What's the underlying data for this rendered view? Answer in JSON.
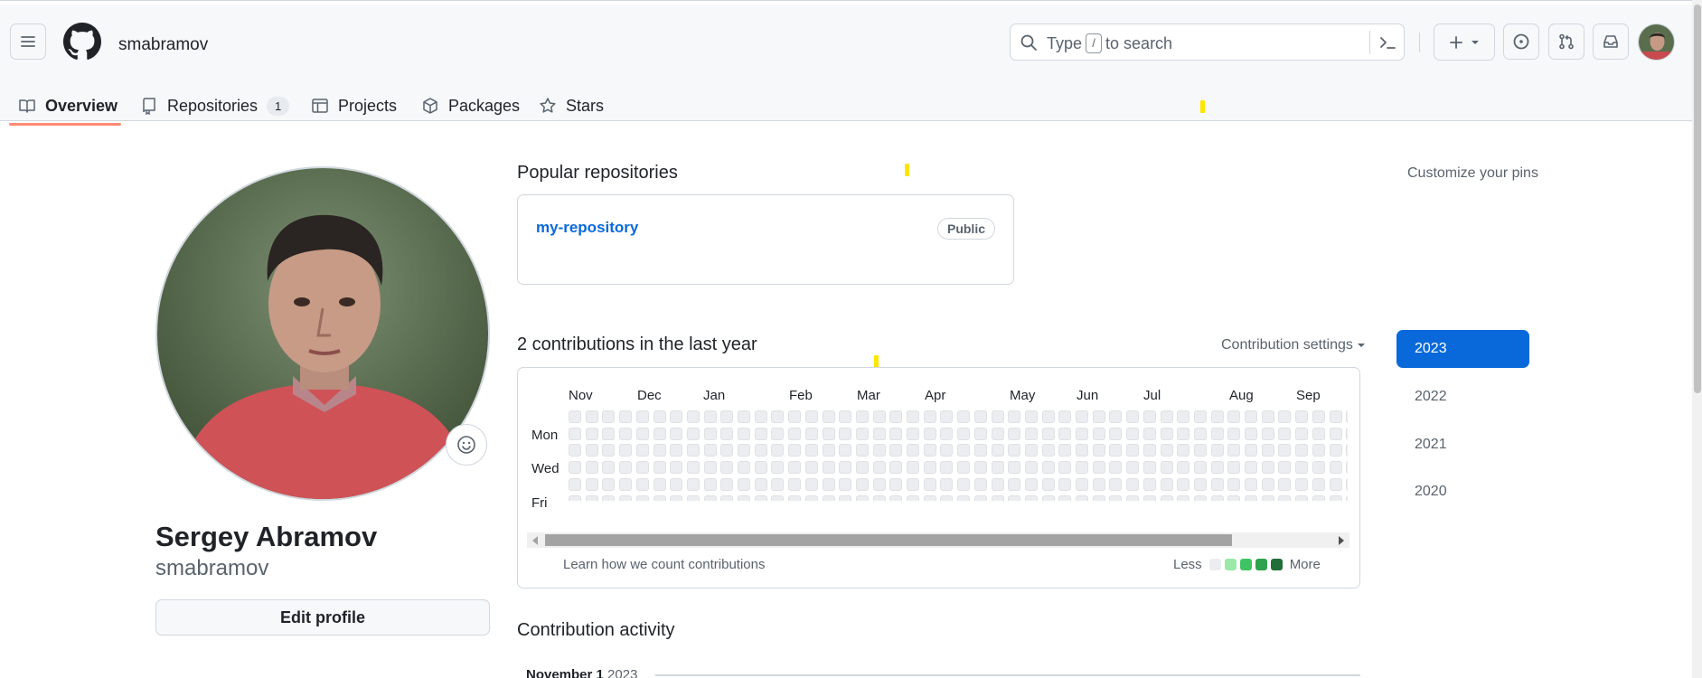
{
  "header": {
    "username": "smabramov",
    "search": {
      "prefix": "Type",
      "key": "/",
      "suffix": "to search"
    }
  },
  "tabs": [
    {
      "label": "Overview",
      "icon": "book-icon",
      "active": true
    },
    {
      "label": "Repositories",
      "icon": "repo-icon",
      "count": "1"
    },
    {
      "label": "Projects",
      "icon": "table-icon"
    },
    {
      "label": "Packages",
      "icon": "package-icon"
    },
    {
      "label": "Stars",
      "icon": "star-icon"
    }
  ],
  "profile": {
    "full_name": "Sergey Abramov",
    "login": "smabramov",
    "edit_label": "Edit profile"
  },
  "popular": {
    "title": "Popular repositories",
    "customize": "Customize your pins",
    "repos": [
      {
        "name": "my-repository",
        "visibility": "Public"
      }
    ]
  },
  "contributions": {
    "title": "2 contributions in the last year",
    "settings_label": "Contribution settings",
    "months": [
      "Nov",
      "Dec",
      "Jan",
      "Feb",
      "Mar",
      "Apr",
      "May",
      "Jun",
      "Jul",
      "Aug",
      "Sep"
    ],
    "days": [
      "Mon",
      "Wed",
      "Fri"
    ],
    "learn": "Learn how we count contributions",
    "legend_less": "Less",
    "legend_more": "More",
    "legend_colors": [
      "#ebedf0",
      "#9be9a8",
      "#40c463",
      "#30a14e",
      "#216e39"
    ]
  },
  "years": [
    "2023",
    "2022",
    "2021",
    "2020"
  ],
  "active_year": "2023",
  "activity": {
    "title": "Contribution activity",
    "month": "November 1",
    "year": "2023"
  },
  "colors": {
    "accent": "#0969da",
    "tab_underline": "#fd8c73"
  }
}
